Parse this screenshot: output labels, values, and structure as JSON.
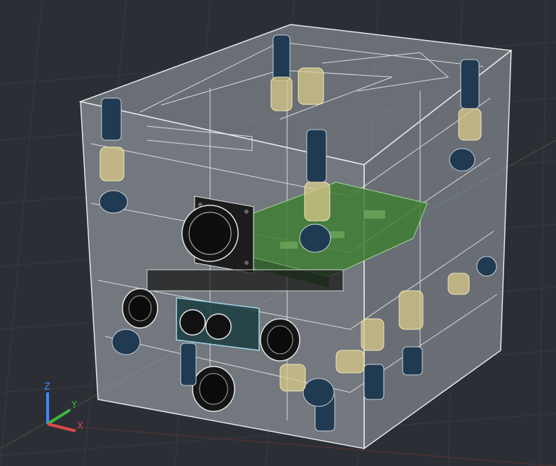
{
  "viewport": {
    "background": "#2b2f35",
    "grid_color": "#3a3f46",
    "wireframe_color": "#e6e8ea",
    "pcb_color": "#3f7f35",
    "bolt_color": "#203a52",
    "spring_color": "#d8c98a",
    "camera_color": "#1a1a1a",
    "lens_color": "#9fd7e6"
  },
  "ucs_icon": {
    "z_label": "Z",
    "y_label": "Y",
    "x_label": "X",
    "z_color": "#3c8cff",
    "y_color": "#3fb53f",
    "x_color": "#e04848"
  }
}
